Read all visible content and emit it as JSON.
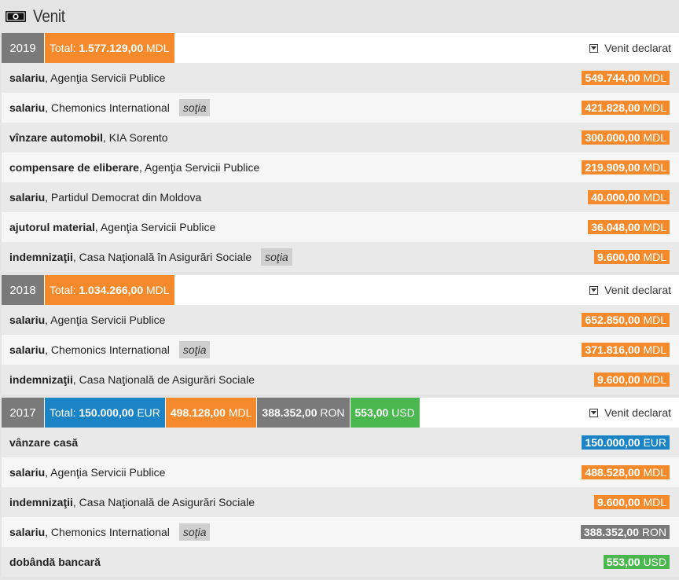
{
  "section": {
    "title": "Venit",
    "icon": "banknote-icon"
  },
  "colors": {
    "mdl": "#f58a2c",
    "eur": "#1a84c6",
    "ron": "#7a7a7a",
    "usd": "#4bb74f"
  },
  "years": [
    {
      "year": "2019",
      "totals": [
        {
          "prefix": "Total: ",
          "amount": "1.577.129,00",
          "currency": "MDL",
          "color": "orange"
        }
      ],
      "declared_label": "Venit declarat",
      "rows": [
        {
          "type": "salariu",
          "source": ", Agenţia Servicii Publice",
          "spouse": "",
          "amount": "549.744,00",
          "currency": "MDL",
          "color": "orange"
        },
        {
          "type": "salariu",
          "source": ", Chemonics International",
          "spouse": "soţia",
          "amount": "421.828,00",
          "currency": "MDL",
          "color": "orange"
        },
        {
          "type": "vînzare automobil",
          "source": ", KIA Sorento",
          "spouse": "",
          "amount": "300.000,00",
          "currency": "MDL",
          "color": "orange"
        },
        {
          "type": "compensare de eliberare",
          "source": ", Agenţia Servicii Publice",
          "spouse": "",
          "amount": "219.909,00",
          "currency": "MDL",
          "color": "orange"
        },
        {
          "type": "salariu",
          "source": ", Partidul Democrat din Moldova",
          "spouse": "",
          "amount": "40.000,00",
          "currency": "MDL",
          "color": "orange"
        },
        {
          "type": "ajutorul material",
          "source": ", Agenţia Servicii Publice",
          "spouse": "",
          "amount": "36.048,00",
          "currency": "MDL",
          "color": "orange"
        },
        {
          "type": "indemnizaţii",
          "source": ", Casa Naţională în Asigurări Sociale",
          "spouse": "soţia",
          "amount": "9.600,00",
          "currency": "MDL",
          "color": "orange"
        }
      ]
    },
    {
      "year": "2018",
      "totals": [
        {
          "prefix": "Total: ",
          "amount": "1.034.266,00",
          "currency": "MDL",
          "color": "orange"
        }
      ],
      "declared_label": "Venit declarat",
      "rows": [
        {
          "type": "salariu",
          "source": ", Agenţia Servicii Publice",
          "spouse": "",
          "amount": "652.850,00",
          "currency": "MDL",
          "color": "orange"
        },
        {
          "type": "salariu",
          "source": ", Chemonics International",
          "spouse": "soţia",
          "amount": "371.816,00",
          "currency": "MDL",
          "color": "orange"
        },
        {
          "type": "indemnizaţii",
          "source": ", Casa Naţională de Asigurări Sociale",
          "spouse": "",
          "amount": "9.600,00",
          "currency": "MDL",
          "color": "orange"
        }
      ]
    },
    {
      "year": "2017",
      "totals": [
        {
          "prefix": "Total: ",
          "amount": "150.000,00",
          "currency": "EUR",
          "color": "blue"
        },
        {
          "prefix": "",
          "amount": "498.128,00",
          "currency": "MDL",
          "color": "orange"
        },
        {
          "prefix": "",
          "amount": "388.352,00",
          "currency": "RON",
          "color": "gray"
        },
        {
          "prefix": "",
          "amount": "553,00",
          "currency": "USD",
          "color": "green"
        }
      ],
      "declared_label": "Venit declarat",
      "rows": [
        {
          "type": "vânzare casă",
          "source": "",
          "spouse": "",
          "amount": "150.000,00",
          "currency": "EUR",
          "color": "blue"
        },
        {
          "type": "salariu",
          "source": ", Agenţia Servicii Publice",
          "spouse": "",
          "amount": "488.528,00",
          "currency": "MDL",
          "color": "orange"
        },
        {
          "type": "indemnizaţii",
          "source": ", Casa Naţională de Asigurări Sociale",
          "spouse": "",
          "amount": "9.600,00",
          "currency": "MDL",
          "color": "orange"
        },
        {
          "type": "salariu",
          "source": ", Chemonics International",
          "spouse": "soţia",
          "amount": "388.352,00",
          "currency": "RON",
          "color": "gray"
        },
        {
          "type": "dobândă bancară",
          "source": "",
          "spouse": "",
          "amount": "553,00",
          "currency": "USD",
          "color": "green"
        }
      ]
    }
  ]
}
